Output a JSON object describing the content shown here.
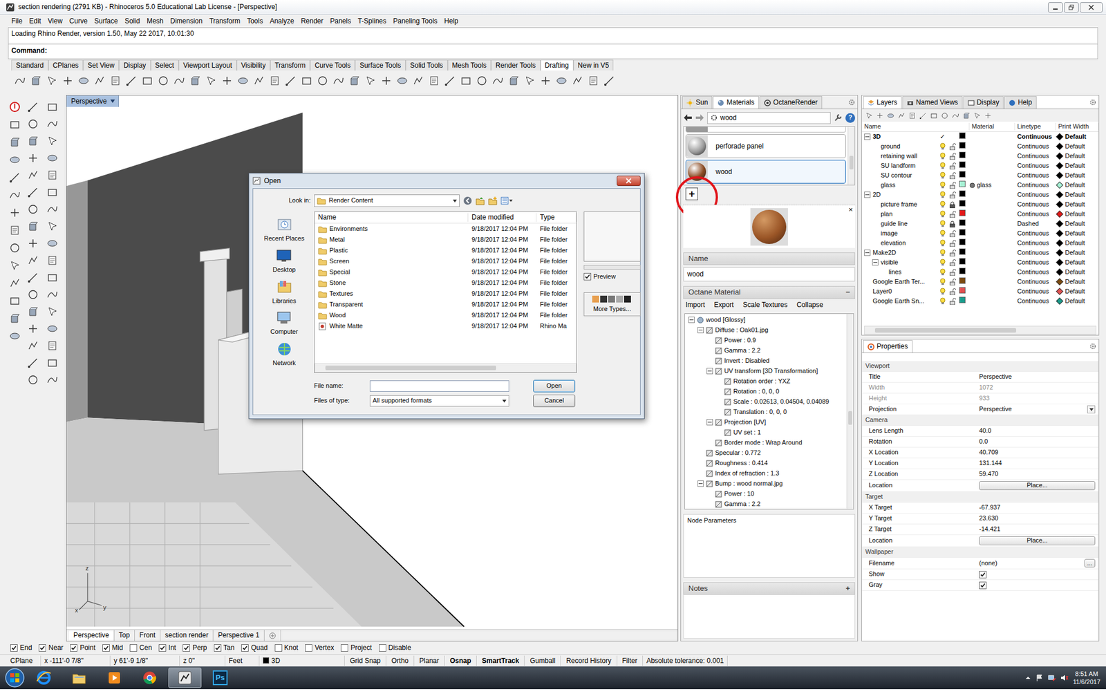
{
  "window": {
    "title": "section rendering (2791 KB) - Rhinoceros 5.0 Educational Lab License - [Perspective]"
  },
  "menu": [
    "File",
    "Edit",
    "View",
    "Curve",
    "Surface",
    "Solid",
    "Mesh",
    "Dimension",
    "Transform",
    "Tools",
    "Analyze",
    "Render",
    "Panels",
    "T-Splines",
    "Paneling Tools",
    "Help"
  ],
  "command": {
    "history": "Loading Rhino Render, version 1.50, May 22 2017, 10:01:30",
    "prompt": "Command:"
  },
  "toolbar_tabs": [
    {
      "label": "Standard",
      "selected": false
    },
    {
      "label": "CPlanes",
      "selected": false
    },
    {
      "label": "Set View",
      "selected": false
    },
    {
      "label": "Display",
      "selected": false
    },
    {
      "label": "Select",
      "selected": false
    },
    {
      "label": "Viewport Layout",
      "selected": false
    },
    {
      "label": "Visibility",
      "selected": false
    },
    {
      "label": "Transform",
      "selected": false
    },
    {
      "label": "Curve Tools",
      "selected": false
    },
    {
      "label": "Surface Tools",
      "selected": false
    },
    {
      "label": "Solid Tools",
      "selected": false
    },
    {
      "label": "Mesh Tools",
      "selected": false
    },
    {
      "label": "Render Tools",
      "selected": false
    },
    {
      "label": "Drafting",
      "selected": true
    },
    {
      "label": "New in V5",
      "selected": false
    }
  ],
  "viewport": {
    "label": "Perspective",
    "axis_labels": [
      "z",
      "x",
      "y"
    ],
    "tabs": [
      {
        "label": "Perspective",
        "selected": true
      },
      {
        "label": "Top",
        "selected": false
      },
      {
        "label": "Front",
        "selected": false
      },
      {
        "label": "section render",
        "selected": false
      },
      {
        "label": "Perspective 1",
        "selected": false
      }
    ]
  },
  "open_dialog": {
    "title": "Open",
    "look_in_label": "Look in:",
    "look_in": "Render Content",
    "places": [
      {
        "label": "Recent Places",
        "kind": "recent"
      },
      {
        "label": "Desktop",
        "kind": "desktop"
      },
      {
        "label": "Libraries",
        "kind": "libraries"
      },
      {
        "label": "Computer",
        "kind": "computer"
      },
      {
        "label": "Network",
        "kind": "network"
      }
    ],
    "columns": [
      "Name",
      "Date modified",
      "Type"
    ],
    "rows": [
      {
        "name": "Environments",
        "date": "9/18/2017 12:04 PM",
        "type": "File folder",
        "kind": "folder"
      },
      {
        "name": "Metal",
        "date": "9/18/2017 12:04 PM",
        "type": "File folder",
        "kind": "folder"
      },
      {
        "name": "Plastic",
        "date": "9/18/2017 12:04 PM",
        "type": "File folder",
        "kind": "folder"
      },
      {
        "name": "Screen",
        "date": "9/18/2017 12:04 PM",
        "type": "File folder",
        "kind": "folder"
      },
      {
        "name": "Special",
        "date": "9/18/2017 12:04 PM",
        "type": "File folder",
        "kind": "folder"
      },
      {
        "name": "Stone",
        "date": "9/18/2017 12:04 PM",
        "type": "File folder",
        "kind": "folder"
      },
      {
        "name": "Textures",
        "date": "9/18/2017 12:04 PM",
        "type": "File folder",
        "kind": "folder"
      },
      {
        "name": "Transparent",
        "date": "9/18/2017 12:04 PM",
        "type": "File folder",
        "kind": "folder"
      },
      {
        "name": "Wood",
        "date": "9/18/2017 12:04 PM",
        "type": "File folder",
        "kind": "folder"
      },
      {
        "name": "White Matte",
        "date": "9/18/2017 12:04 PM",
        "type": "Rhino Ma",
        "kind": "material"
      }
    ],
    "preview": {
      "label": "Preview",
      "checked": true
    },
    "more_types": "More Types...",
    "file_name_label": "File name:",
    "file_name": "",
    "files_of_type_label": "Files of type:",
    "files_of_type": "All supported formats",
    "buttons": [
      {
        "label": "Open",
        "default": true
      },
      {
        "label": "Cancel",
        "default": false
      }
    ]
  },
  "materials_panel": {
    "tabs": [
      {
        "label": "Sun",
        "selected": false
      },
      {
        "label": "Materials",
        "selected": true
      },
      {
        "label": "OctaneRender",
        "selected": false
      }
    ],
    "breadcrumb": "wood",
    "help": "?",
    "items": [
      {
        "name": "perforade panel",
        "selected": false,
        "color": "#9c9c9c"
      },
      {
        "name": "wood",
        "selected": true,
        "color": "#8a4a22"
      }
    ],
    "add": "+",
    "preview_close": "×",
    "name_label": "Name",
    "name_value": "wood",
    "octane_label": "Octane Material",
    "octane_collapse": "−",
    "actions": [
      "Import",
      "Export",
      "Scale Textures",
      "Collapse"
    ],
    "tree": [
      {
        "text": "wood  [Glossy]",
        "depth": 0,
        "kind": "branch",
        "expanded": true
      },
      {
        "text": "Diffuse : Oak01.jpg",
        "depth": 1,
        "kind": "branch",
        "expanded": true
      },
      {
        "text": "Power : 0.9",
        "depth": 2,
        "kind": "leaf",
        "expanded": false
      },
      {
        "text": "Gamma : 2.2",
        "depth": 2,
        "kind": "leaf",
        "expanded": false
      },
      {
        "text": "Invert : Disabled",
        "depth": 2,
        "kind": "leaf",
        "expanded": false
      },
      {
        "text": "UV transform  [3D Transformation]",
        "depth": 2,
        "kind": "branch",
        "expanded": true
      },
      {
        "text": "Rotation order : YXZ",
        "depth": 3,
        "kind": "leaf",
        "expanded": false
      },
      {
        "text": "Rotation : 0, 0, 0",
        "depth": 3,
        "kind": "leaf",
        "expanded": false
      },
      {
        "text": "Scale : 0.02613, 0.04504, 0.04089",
        "depth": 3,
        "kind": "leaf",
        "expanded": false
      },
      {
        "text": "Translation : 0, 0, 0",
        "depth": 3,
        "kind": "leaf",
        "expanded": false
      },
      {
        "text": "Projection  [UV]",
        "depth": 2,
        "kind": "branch",
        "expanded": true
      },
      {
        "text": "UV set : 1",
        "depth": 3,
        "kind": "leaf",
        "expanded": false
      },
      {
        "text": "Border mode : Wrap Around",
        "depth": 2,
        "kind": "leaf",
        "expanded": false
      },
      {
        "text": "Specular : 0.772",
        "depth": 1,
        "kind": "leaf",
        "expanded": false
      },
      {
        "text": "Roughness : 0.414",
        "depth": 1,
        "kind": "leaf",
        "expanded": false
      },
      {
        "text": "Index of refraction : 1.3",
        "depth": 1,
        "kind": "leaf",
        "expanded": false
      },
      {
        "text": "Bump : wood normal.jpg",
        "depth": 1,
        "kind": "branch",
        "expanded": true
      },
      {
        "text": "Power : 10",
        "depth": 2,
        "kind": "leaf",
        "expanded": false
      },
      {
        "text": "Gamma : 2.2",
        "depth": 2,
        "kind": "leaf",
        "expanded": false
      }
    ],
    "node_parameters": "Node Parameters",
    "notes_label": "Notes",
    "notes_add": "+"
  },
  "layers_panel": {
    "tabs": [
      {
        "label": "Layers",
        "selected": true
      },
      {
        "label": "Named Views",
        "selected": false
      },
      {
        "label": "Display",
        "selected": false
      },
      {
        "label": "Help",
        "selected": false
      }
    ],
    "columns": [
      "Name",
      "Material",
      "Linetype",
      "Print Width"
    ],
    "current_glyph": "✓",
    "rows": [
      {
        "name": "3D",
        "depth": 0,
        "kind": "group",
        "expanded": true,
        "current": true,
        "on": true,
        "locked": false,
        "color": "#000000",
        "material": "",
        "linetype": "Continuous",
        "print_width": "Default",
        "print_color": "#000000"
      },
      {
        "name": "ground",
        "depth": 1,
        "kind": "layer",
        "expanded": false,
        "current": false,
        "on": true,
        "locked": false,
        "color": "#000000",
        "material": "",
        "linetype": "Continuous",
        "print_width": "Default",
        "print_color": "#000000"
      },
      {
        "name": "retaining wall",
        "depth": 1,
        "kind": "layer",
        "expanded": false,
        "current": false,
        "on": true,
        "locked": false,
        "color": "#000000",
        "material": "",
        "linetype": "Continuous",
        "print_width": "Default",
        "print_color": "#000000"
      },
      {
        "name": "SU landform",
        "depth": 1,
        "kind": "layer",
        "expanded": false,
        "current": false,
        "on": true,
        "locked": false,
        "color": "#000000",
        "material": "",
        "linetype": "Continuous",
        "print_width": "Default",
        "print_color": "#000000"
      },
      {
        "name": "SU contour",
        "depth": 1,
        "kind": "layer",
        "expanded": false,
        "current": false,
        "on": true,
        "locked": false,
        "color": "#000000",
        "material": "",
        "linetype": "Continuous",
        "print_width": "Default",
        "print_color": "#000000"
      },
      {
        "name": "glass",
        "depth": 1,
        "kind": "layer",
        "expanded": false,
        "current": false,
        "on": true,
        "locked": false,
        "color": "#a6f0d4",
        "material": "glass",
        "linetype": "Continuous",
        "print_width": "Default",
        "print_color": "#a6f0d4"
      },
      {
        "name": "2D",
        "depth": 0,
        "kind": "group",
        "expanded": true,
        "current": false,
        "on": true,
        "locked": false,
        "color": "#000000",
        "material": "",
        "linetype": "Continuous",
        "print_width": "Default",
        "print_color": "#000000"
      },
      {
        "name": "picture frame",
        "depth": 1,
        "kind": "layer",
        "expanded": false,
        "current": false,
        "on": true,
        "locked": true,
        "color": "#000000",
        "material": "",
        "linetype": "Continuous",
        "print_width": "Default",
        "print_color": "#000000"
      },
      {
        "name": "plan",
        "depth": 1,
        "kind": "layer",
        "expanded": false,
        "current": false,
        "on": true,
        "locked": false,
        "color": "#e01818",
        "material": "",
        "linetype": "Continuous",
        "print_width": "Default",
        "print_color": "#e01818"
      },
      {
        "name": "guide line",
        "depth": 1,
        "kind": "layer",
        "expanded": false,
        "current": false,
        "on": true,
        "locked": true,
        "color": "#000000",
        "material": "",
        "linetype": "Dashed",
        "print_width": "Default",
        "print_color": "#000000"
      },
      {
        "name": "image",
        "depth": 1,
        "kind": "layer",
        "expanded": false,
        "current": false,
        "on": true,
        "locked": false,
        "color": "#000000",
        "material": "",
        "linetype": "Continuous",
        "print_width": "Default",
        "print_color": "#000000"
      },
      {
        "name": "elevation",
        "depth": 1,
        "kind": "layer",
        "expanded": false,
        "current": false,
        "on": true,
        "locked": false,
        "color": "#000000",
        "material": "",
        "linetype": "Continuous",
        "print_width": "Default",
        "print_color": "#000000"
      },
      {
        "name": "Make2D",
        "depth": 0,
        "kind": "group",
        "expanded": true,
        "current": false,
        "on": true,
        "locked": false,
        "color": "#000000",
        "material": "",
        "linetype": "Continuous",
        "print_width": "Default",
        "print_color": "#000000"
      },
      {
        "name": "visible",
        "depth": 1,
        "kind": "group",
        "expanded": true,
        "current": false,
        "on": true,
        "locked": false,
        "color": "#000000",
        "material": "",
        "linetype": "Continuous",
        "print_width": "Default",
        "print_color": "#000000"
      },
      {
        "name": "lines",
        "depth": 2,
        "kind": "layer",
        "expanded": false,
        "current": false,
        "on": true,
        "locked": false,
        "color": "#000000",
        "material": "",
        "linetype": "Continuous",
        "print_width": "Default",
        "print_color": "#000000"
      },
      {
        "name": "Google Earth Ter...",
        "depth": 0,
        "kind": "layer",
        "expanded": false,
        "current": false,
        "on": true,
        "locked": false,
        "color": "#7a4a10",
        "material": "",
        "linetype": "Continuous",
        "print_width": "Default",
        "print_color": "#7a4a10"
      },
      {
        "name": "Layer0",
        "depth": 0,
        "kind": "layer",
        "expanded": false,
        "current": false,
        "on": true,
        "locked": false,
        "color": "#e05050",
        "material": "",
        "linetype": "Continuous",
        "print_width": "Default",
        "print_color": "#e05050"
      },
      {
        "name": "Google Earth Sn...",
        "depth": 0,
        "kind": "layer",
        "expanded": false,
        "current": false,
        "on": true,
        "locked": false,
        "color": "#1a9a8a",
        "material": "",
        "linetype": "Continuous",
        "print_width": "Default",
        "print_color": "#1a9a8a"
      }
    ]
  },
  "properties": {
    "tab": "Properties",
    "sections": [
      {
        "title": "Viewport",
        "rows": [
          {
            "label": "Title",
            "value": "Perspective",
            "kind": "text",
            "disabled": false
          },
          {
            "label": "Width",
            "value": "1072",
            "kind": "text",
            "disabled": true
          },
          {
            "label": "Height",
            "value": "933",
            "kind": "text",
            "disabled": true
          },
          {
            "label": "Projection",
            "value": "Perspective",
            "kind": "select",
            "disabled": false
          }
        ]
      },
      {
        "title": "Camera",
        "rows": [
          {
            "label": "Lens Length",
            "value": "40.0",
            "kind": "text",
            "disabled": false
          },
          {
            "label": "Rotation",
            "value": "0.0",
            "kind": "text",
            "disabled": false
          },
          {
            "label": "X Location",
            "value": "40.709",
            "kind": "text",
            "disabled": false
          },
          {
            "label": "Y Location",
            "value": "131.144",
            "kind": "text",
            "disabled": false
          },
          {
            "label": "Z Location",
            "value": "59.470",
            "kind": "text",
            "disabled": false
          },
          {
            "label": "Location",
            "value": "Place...",
            "kind": "button",
            "disabled": false
          }
        ]
      },
      {
        "title": "Target",
        "rows": [
          {
            "label": "X Target",
            "value": "-67.937",
            "kind": "text",
            "disabled": false
          },
          {
            "label": "Y Target",
            "value": "23.630",
            "kind": "text",
            "disabled": false
          },
          {
            "label": "Z Target",
            "value": "-14.421",
            "kind": "text",
            "disabled": false
          },
          {
            "label": "Location",
            "value": "Place...",
            "kind": "button",
            "disabled": false
          }
        ]
      },
      {
        "title": "Wallpaper",
        "rows": [
          {
            "label": "Filename",
            "value": "(none)",
            "kind": "file",
            "button": "...",
            "disabled": false
          },
          {
            "label": "Show",
            "kind": "check",
            "checked": true,
            "disabled": false
          },
          {
            "label": "Gray",
            "kind": "check",
            "checked": true,
            "disabled": false
          }
        ]
      }
    ]
  },
  "osnap": [
    {
      "label": "End",
      "checked": true
    },
    {
      "label": "Near",
      "checked": true
    },
    {
      "label": "Point",
      "checked": true
    },
    {
      "label": "Mid",
      "checked": true
    },
    {
      "label": "Cen",
      "checked": false
    },
    {
      "label": "Int",
      "checked": true
    },
    {
      "label": "Perp",
      "checked": true
    },
    {
      "label": "Tan",
      "checked": true
    },
    {
      "label": "Quad",
      "checked": true
    },
    {
      "label": "Knot",
      "checked": false
    },
    {
      "label": "Vertex",
      "checked": false
    },
    {
      "label": "Project",
      "checked": false
    },
    {
      "label": "Disable",
      "checked": false
    }
  ],
  "status_bar": {
    "cplane": "CPlane",
    "x": "x -111'-0 7/8\"",
    "y": "y 61'-9 1/8\"",
    "z": "z 0\"",
    "units": "Feet",
    "layer": "3D",
    "layer_color": "#000000",
    "toggles": [
      {
        "label": "Grid Snap",
        "on": false
      },
      {
        "label": "Ortho",
        "on": false
      },
      {
        "label": "Planar",
        "on": false
      },
      {
        "label": "Osnap",
        "on": true
      },
      {
        "label": "SmartTrack",
        "on": true
      },
      {
        "label": "Gumball",
        "on": false
      },
      {
        "label": "Record History",
        "on": false
      },
      {
        "label": "Filter",
        "on": false
      }
    ],
    "tolerance": "Absolute tolerance: 0.001"
  },
  "taskbar": {
    "apps": [
      {
        "kind": "ie",
        "active": false,
        "label": ""
      },
      {
        "kind": "explorer",
        "active": false,
        "label": ""
      },
      {
        "kind": "media",
        "active": false,
        "label": ""
      },
      {
        "kind": "chrome",
        "active": false,
        "label": ""
      },
      {
        "kind": "rhino",
        "active": true,
        "label": ""
      },
      {
        "kind": "photoshop",
        "active": false,
        "label": "Ps"
      }
    ],
    "time": "8:51 AM",
    "date": "11/6/2017"
  }
}
